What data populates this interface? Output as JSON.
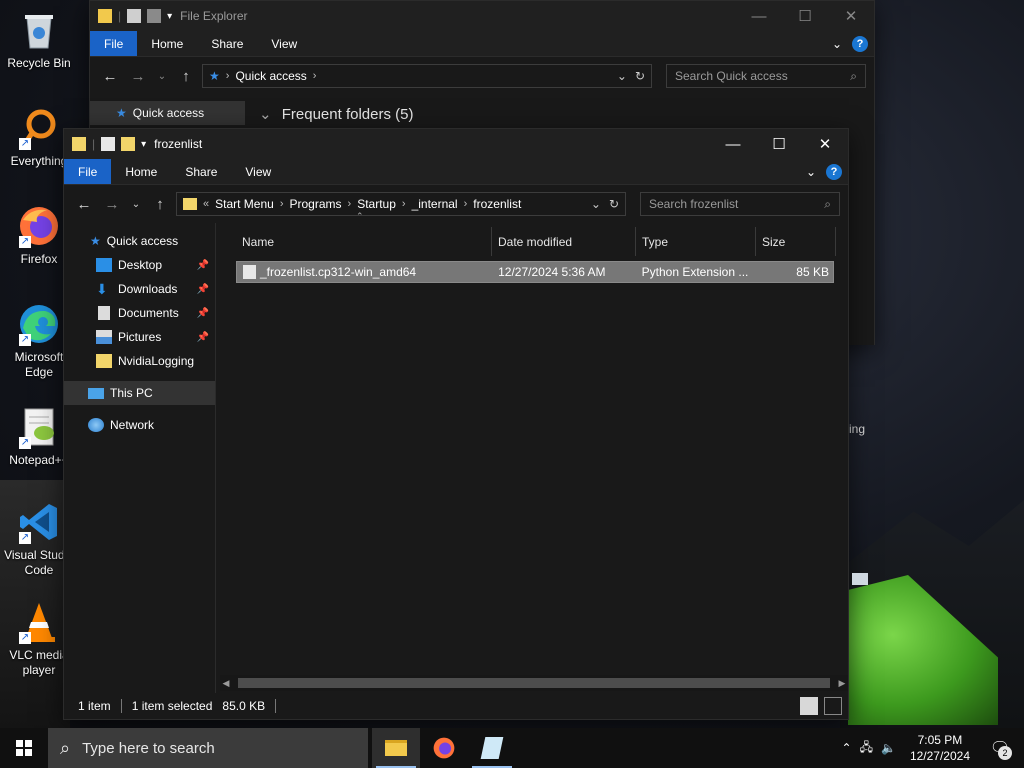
{
  "desktop": {
    "icons": [
      {
        "label": "Recycle Bin",
        "icon": "recycle-bin-icon"
      },
      {
        "label": "Everything",
        "icon": "everything-icon"
      },
      {
        "label": "Firefox",
        "icon": "firefox-icon"
      },
      {
        "label": "Microsoft Edge",
        "icon": "edge-icon"
      },
      {
        "label": "Notepad++",
        "icon": "notepadpp-icon"
      },
      {
        "label": "Visual Studio Code",
        "icon": "vscode-icon"
      },
      {
        "label": "VLC media player",
        "icon": "vlc-icon"
      }
    ],
    "partial_text_behind": "ing"
  },
  "back_window": {
    "title": "File Explorer",
    "ribbon_tabs": [
      "File",
      "Home",
      "Share",
      "View"
    ],
    "address": {
      "current": "Quick access"
    },
    "search_placeholder": "Search Quick access",
    "nav_selected": "Quick access",
    "section_heading": "Frequent folders (5)"
  },
  "front_window": {
    "title": "frozenlist",
    "ribbon_tabs": [
      "File",
      "Home",
      "Share",
      "View"
    ],
    "address": {
      "overflow": "«",
      "segments": [
        "Start Menu",
        "Programs",
        "Startup",
        "_internal",
        "frozenlist"
      ]
    },
    "search_placeholder": "Search frozenlist",
    "nav": {
      "quick_access": "Quick access",
      "pinned": [
        {
          "label": "Desktop",
          "pinned": true
        },
        {
          "label": "Downloads",
          "pinned": true
        },
        {
          "label": "Documents",
          "pinned": true
        },
        {
          "label": "Pictures",
          "pinned": true
        },
        {
          "label": "NvidiaLogging",
          "pinned": false
        }
      ],
      "this_pc": "This PC",
      "network": "Network"
    },
    "columns": [
      "Name",
      "Date modified",
      "Type",
      "Size"
    ],
    "files": [
      {
        "name": "_frozenlist.cp312-win_amd64",
        "date_modified": "12/27/2024 5:36 AM",
        "type": "Python Extension ...",
        "size": "85 KB"
      }
    ],
    "status": {
      "item_count": "1 item",
      "selected": "1 item selected",
      "selected_size": "85.0 KB"
    }
  },
  "taskbar": {
    "search_placeholder": "Type here to search",
    "time": "7:05 PM",
    "date": "12/27/2024",
    "notification_count": "2"
  },
  "colors": {
    "accent": "#1a63c7",
    "window_bg": "#191919",
    "titlebar_bg": "#202020",
    "selection_row": "#777777"
  }
}
